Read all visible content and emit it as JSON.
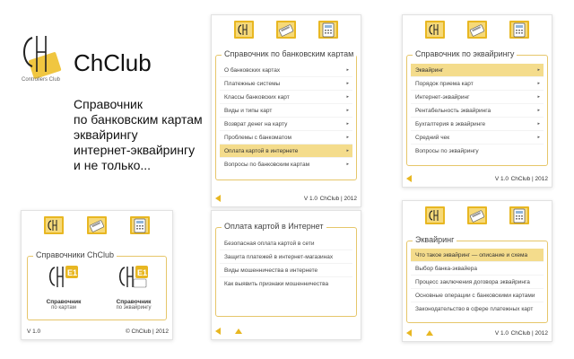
{
  "promo": {
    "logo_small_text": "Controllers Club",
    "brand": "ChClub",
    "tagline": [
      "Справочник",
      "по банковским картам",
      "эквайрингу",
      "интернет-эквайрингу",
      "и не только..."
    ]
  },
  "colors": {
    "accent": "#e8b722",
    "highlight": "#f4dc8c",
    "border": "#e6c66a"
  },
  "icons": [
    "chclub-home-icon",
    "card-reader-icon",
    "card-terminal-icon"
  ],
  "panel_cards": {
    "title": "Справочник по банковским картам",
    "items": [
      {
        "label": "О банковских картах",
        "arrow": "▸",
        "active": false
      },
      {
        "label": "Платежные системы",
        "arrow": "▸",
        "active": false
      },
      {
        "label": "Классы банковских карт",
        "arrow": "▸",
        "active": false
      },
      {
        "label": "Виды и типы карт",
        "arrow": "▸",
        "active": false
      },
      {
        "label": "Возврат денег на карту",
        "arrow": "▸",
        "active": false
      },
      {
        "label": "Проблемы с банкоматом",
        "arrow": "▸",
        "active": false
      },
      {
        "label": "Оплата картой в интернете",
        "arrow": "▸",
        "active": true
      },
      {
        "label": "Вопросы по банковским картам",
        "arrow": "▸",
        "active": false
      }
    ],
    "version": "V 1.0",
    "copyright": "ChClub | 2012"
  },
  "panel_acquiring": {
    "title": "Справочник по эквайрингу",
    "items": [
      {
        "label": "Эквайринг",
        "arrow": "▸",
        "active": true
      },
      {
        "label": "Порядок приема карт",
        "arrow": "▸",
        "active": false
      },
      {
        "label": "Интернет-эквайринг",
        "arrow": "▸",
        "active": false
      },
      {
        "label": "Рентабельность эквайринга",
        "arrow": "▸",
        "active": false
      },
      {
        "label": "Бухгалтерия в эквайринге",
        "arrow": "▸",
        "active": false
      },
      {
        "label": "Средний чек",
        "arrow": "▸",
        "active": false
      },
      {
        "label": "Вопросы по эквайрингу",
        "arrow": "",
        "active": false
      }
    ],
    "version": "V 1.0",
    "copyright": "ChClub | 2012"
  },
  "panel_home": {
    "title": "Справочники ChClub",
    "book1": {
      "name": "Справочник",
      "sub": "по картам"
    },
    "book2": {
      "name": "Справочник",
      "sub": "по эквайрингу"
    },
    "version": "V 1.0",
    "copyright": "© ChClub | 2012"
  },
  "panel_internet": {
    "title": "Оплата картой в Интернет",
    "items": [
      "Безопасная оплата картой в сети",
      "Защита платежей в интернет-магазинах",
      "Виды мошенничества в интернете",
      "Как выявить признаки мошенничества"
    ]
  },
  "panel_acq_detail": {
    "title": "Эквайринг",
    "items": [
      {
        "label": "Что такое эквайринг — описание и схема",
        "active": true
      },
      {
        "label": "Выбор банка-эквайера",
        "active": false
      },
      {
        "label": "Процесс заключения договора эквайринга",
        "active": false
      },
      {
        "label": "Основные операции с банковскими картами",
        "active": false
      },
      {
        "label": "Законодательство в сфере платежных карт",
        "active": false
      }
    ],
    "version": "V 1.0",
    "copyright": "ChClub | 2012"
  }
}
